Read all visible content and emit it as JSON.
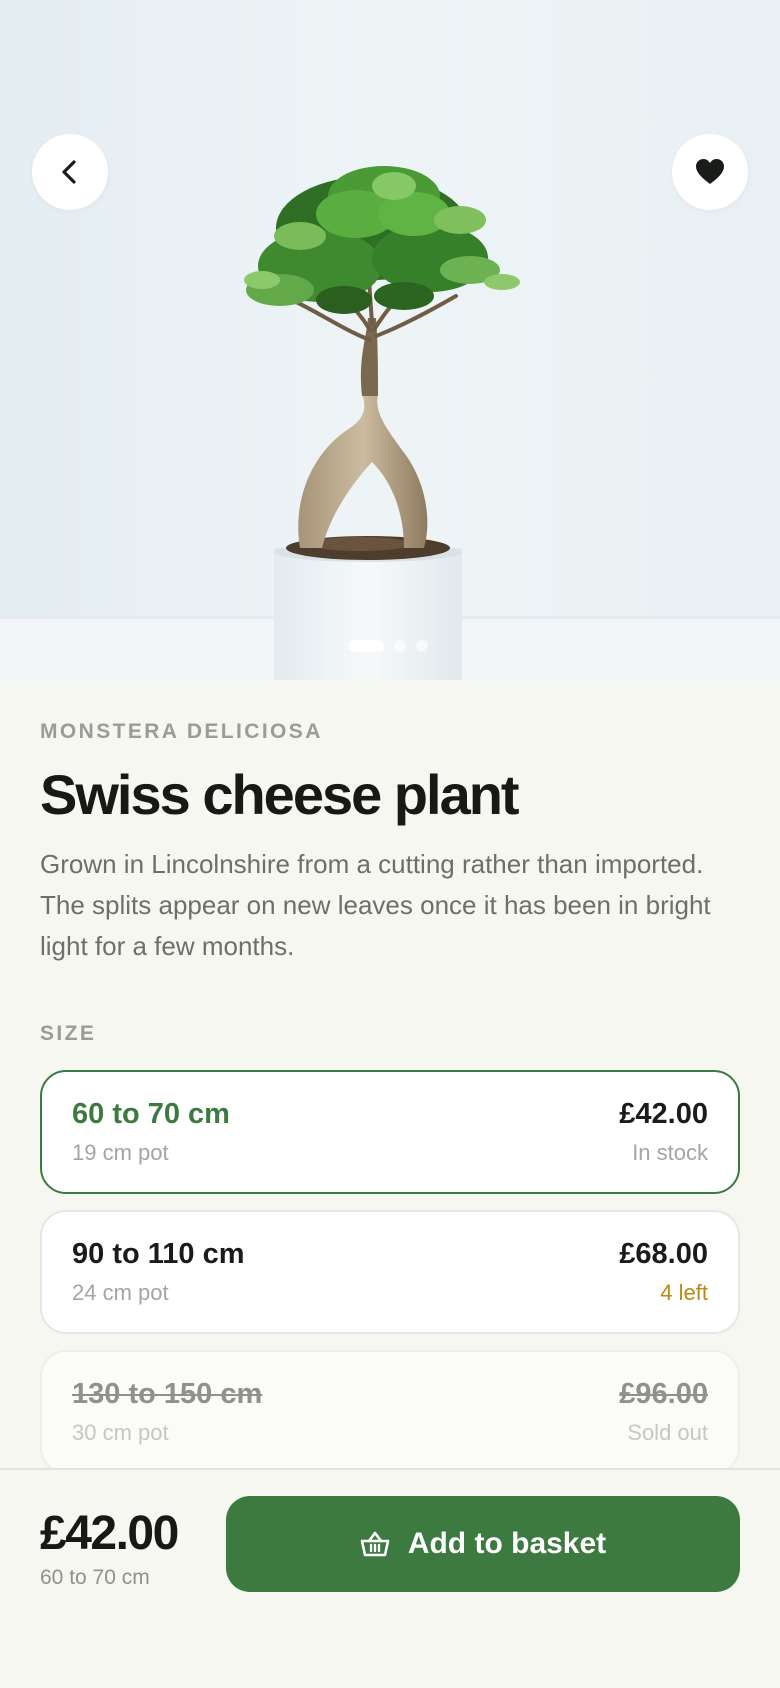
{
  "hero": {
    "image_icon": "bonsai-plant-photo",
    "back_icon": "chevron-left-icon",
    "favorite_icon": "heart-icon",
    "carousel": {
      "count": 3,
      "active": 1
    }
  },
  "product": {
    "latin_name": "MONSTERA DELICIOSA",
    "name": "Swiss cheese plant",
    "description": "Grown in Lincolnshire from a cutting rather than imported. The splits appear on new leaves once it has been in bright light for a few months."
  },
  "size_section": {
    "label": "SIZE",
    "options": [
      {
        "size": "60 to 70 cm",
        "pot": "19 cm pot",
        "price": "£42.00",
        "stock": "In stock",
        "state": "selected"
      },
      {
        "size": "90 to 110 cm",
        "pot": "24 cm pot",
        "price": "£68.00",
        "stock": "4 left",
        "state": "low-stock"
      },
      {
        "size": "130 to 150 cm",
        "pot": "30 cm pot",
        "price": "£96.00",
        "stock": "Sold out",
        "state": "sold-out"
      }
    ]
  },
  "footer": {
    "price": "£42.00",
    "selected_size": "60 to 70 cm",
    "cta_label": "Add to basket",
    "cta_icon": "basket-icon"
  },
  "colors": {
    "accent": "#3d7a3f",
    "low_stock": "#b88a14",
    "background": "#f7f7f2"
  }
}
